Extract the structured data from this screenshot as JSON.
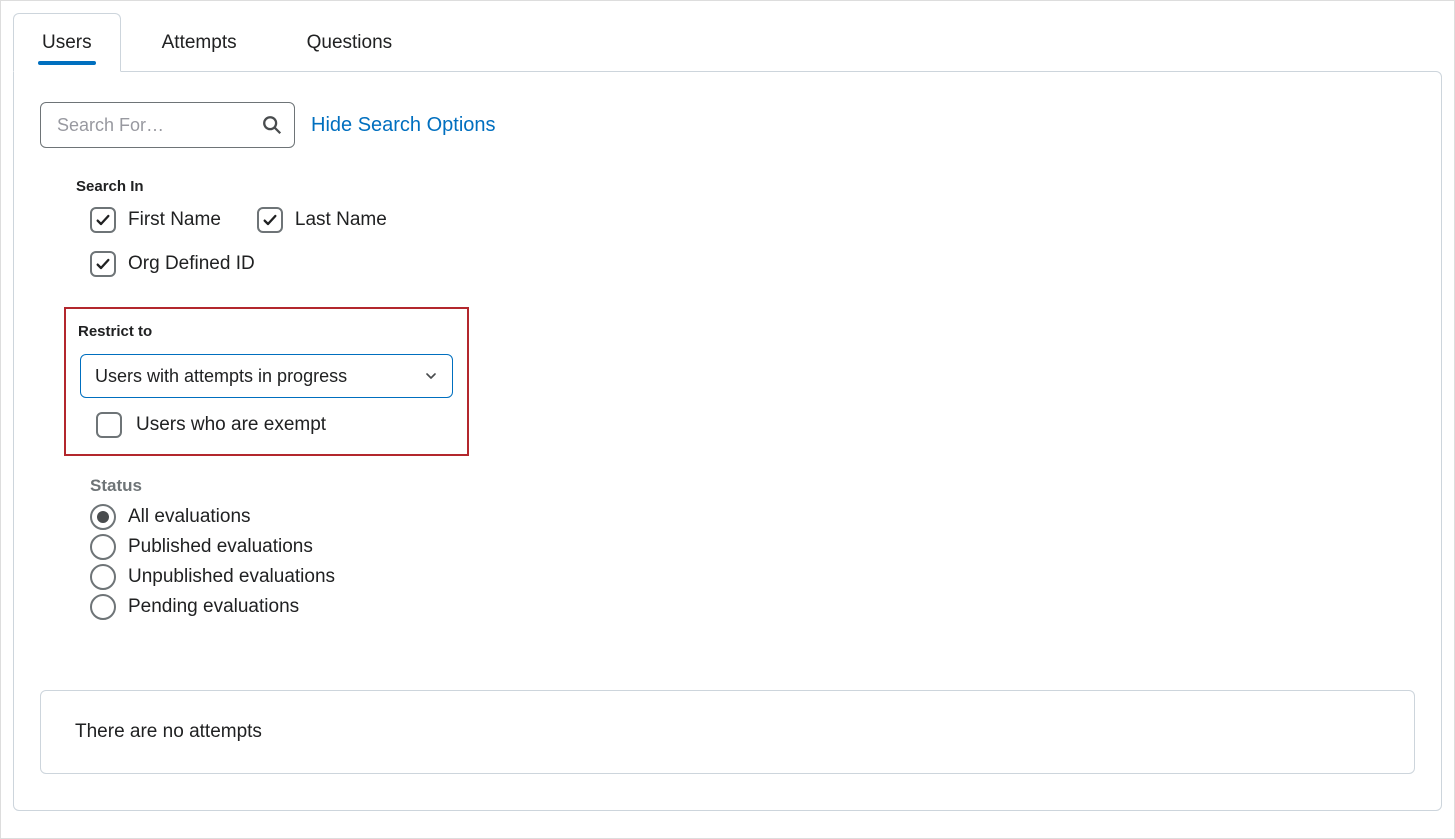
{
  "tabs": {
    "users": "Users",
    "attempts": "Attempts",
    "questions": "Questions"
  },
  "search": {
    "placeholder": "Search For…",
    "hide_options_label": "Hide Search Options"
  },
  "search_in": {
    "label": "Search In",
    "first_name": "First Name",
    "last_name": "Last Name",
    "org_defined_id": "Org Defined ID"
  },
  "restrict": {
    "label": "Restrict to",
    "selected": "Users with attempts in progress",
    "exempt_label": "Users who are exempt"
  },
  "status": {
    "label": "Status",
    "options": {
      "all": "All evaluations",
      "published": "Published evaluations",
      "unpublished": "Unpublished evaluations",
      "pending": "Pending evaluations"
    }
  },
  "empty_message": "There are no attempts"
}
